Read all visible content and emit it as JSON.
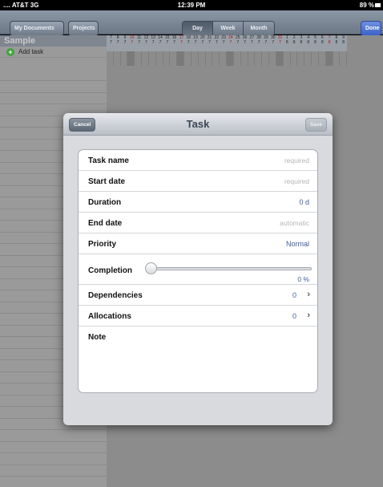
{
  "status_bar": {
    "carrier": ".... AT&T 3G",
    "time": "12:39 PM",
    "battery": "89 %"
  },
  "toolbar": {
    "my_documents": "My Documents",
    "projects": "Projects",
    "done": "Done",
    "segments": [
      {
        "label": "Day",
        "active": true
      },
      {
        "label": "Week",
        "active": false
      },
      {
        "label": "Month",
        "active": false
      }
    ]
  },
  "sidebar": {
    "title": "Sample",
    "add_task": "Add task"
  },
  "gantt": {
    "days": [
      "7",
      "8",
      "9",
      "10",
      "11",
      "12",
      "13",
      "14",
      "15",
      "16",
      "17",
      "18",
      "19",
      "20",
      "21",
      "22",
      "23",
      "24",
      "25",
      "26",
      "27",
      "28",
      "29",
      "30",
      "31",
      "1",
      "2",
      "3",
      "4",
      "5",
      "6",
      "7",
      "8",
      "9"
    ],
    "weekend_days": [
      "10",
      "17",
      "24",
      "31",
      "7"
    ],
    "hours_row": [
      "7",
      "7",
      "7",
      "7",
      "7",
      "7",
      "7",
      "7",
      "7",
      "7",
      "7",
      "7",
      "7",
      "7",
      "7",
      "7",
      "7",
      "7",
      "7",
      "7",
      "7",
      "7",
      "7",
      "7",
      "7",
      "8",
      "8",
      "8",
      "8",
      "8",
      "8",
      "8",
      "8",
      "8"
    ]
  },
  "modal": {
    "title": "Task",
    "cancel": "Cancel",
    "save": "Save",
    "fields": {
      "task_name": {
        "label": "Task name",
        "placeholder": "required"
      },
      "start_date": {
        "label": "Start date",
        "placeholder": "required"
      },
      "duration": {
        "label": "Duration",
        "value": "0 d"
      },
      "end_date": {
        "label": "End date",
        "placeholder": "automatic"
      },
      "priority": {
        "label": "Priority",
        "value": "Normal"
      },
      "completion": {
        "label": "Completion",
        "value": "0 %",
        "fraction": 0
      },
      "dependencies": {
        "label": "Dependencies",
        "count": "0"
      },
      "allocations": {
        "label": "Allocations",
        "count": "0"
      },
      "note": {
        "label": "Note"
      }
    }
  },
  "colors": {
    "toolbar": "#7a8593",
    "done_button": "#4a6fd0",
    "value_blue": "#3e5f9a",
    "add_icon": "#3fa33f",
    "weekend": "#b01010"
  }
}
